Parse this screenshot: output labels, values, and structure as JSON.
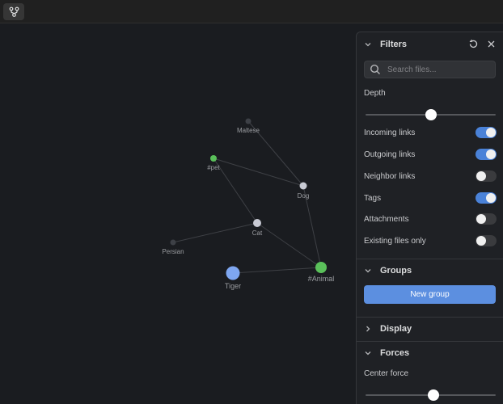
{
  "toolbar": {
    "graph_button_icon": "graph-icon"
  },
  "graph": {
    "nodes": [
      {
        "id": "maltese",
        "label": "Maltese",
        "color": "#3d4046"
      },
      {
        "id": "pet",
        "label": "#pet",
        "color": "#5ac05a"
      },
      {
        "id": "dog",
        "label": "Dog",
        "color": "#c8cad4"
      },
      {
        "id": "cat",
        "label": "Cat",
        "color": "#c8cad4"
      },
      {
        "id": "persian",
        "label": "Persian",
        "color": "#3d4046"
      },
      {
        "id": "tiger",
        "label": "Tiger",
        "color": "#7ea6f0"
      },
      {
        "id": "animal",
        "label": "#Animal",
        "color": "#5ac05a"
      }
    ],
    "edges": [
      [
        "maltese",
        "dog"
      ],
      [
        "pet",
        "dog"
      ],
      [
        "pet",
        "cat"
      ],
      [
        "dog",
        "animal"
      ],
      [
        "cat",
        "persian"
      ],
      [
        "cat",
        "animal"
      ],
      [
        "tiger",
        "animal"
      ]
    ]
  },
  "filters": {
    "title": "Filters",
    "search_placeholder": "Search files...",
    "depth_label": "Depth",
    "depth_value": 0.5,
    "options": [
      {
        "label": "Incoming links",
        "on": true
      },
      {
        "label": "Outgoing links",
        "on": true
      },
      {
        "label": "Neighbor links",
        "on": false
      },
      {
        "label": "Tags",
        "on": true
      },
      {
        "label": "Attachments",
        "on": false
      },
      {
        "label": "Existing files only",
        "on": false
      }
    ]
  },
  "groups": {
    "title": "Groups",
    "new_group_label": "New group"
  },
  "display": {
    "title": "Display"
  },
  "forces": {
    "title": "Forces",
    "center_force_label": "Center force",
    "center_force_value": 0.52
  },
  "colors": {
    "accent": "#4a82d8",
    "button": "#5c8fe0",
    "tag_node": "#5ac05a"
  }
}
